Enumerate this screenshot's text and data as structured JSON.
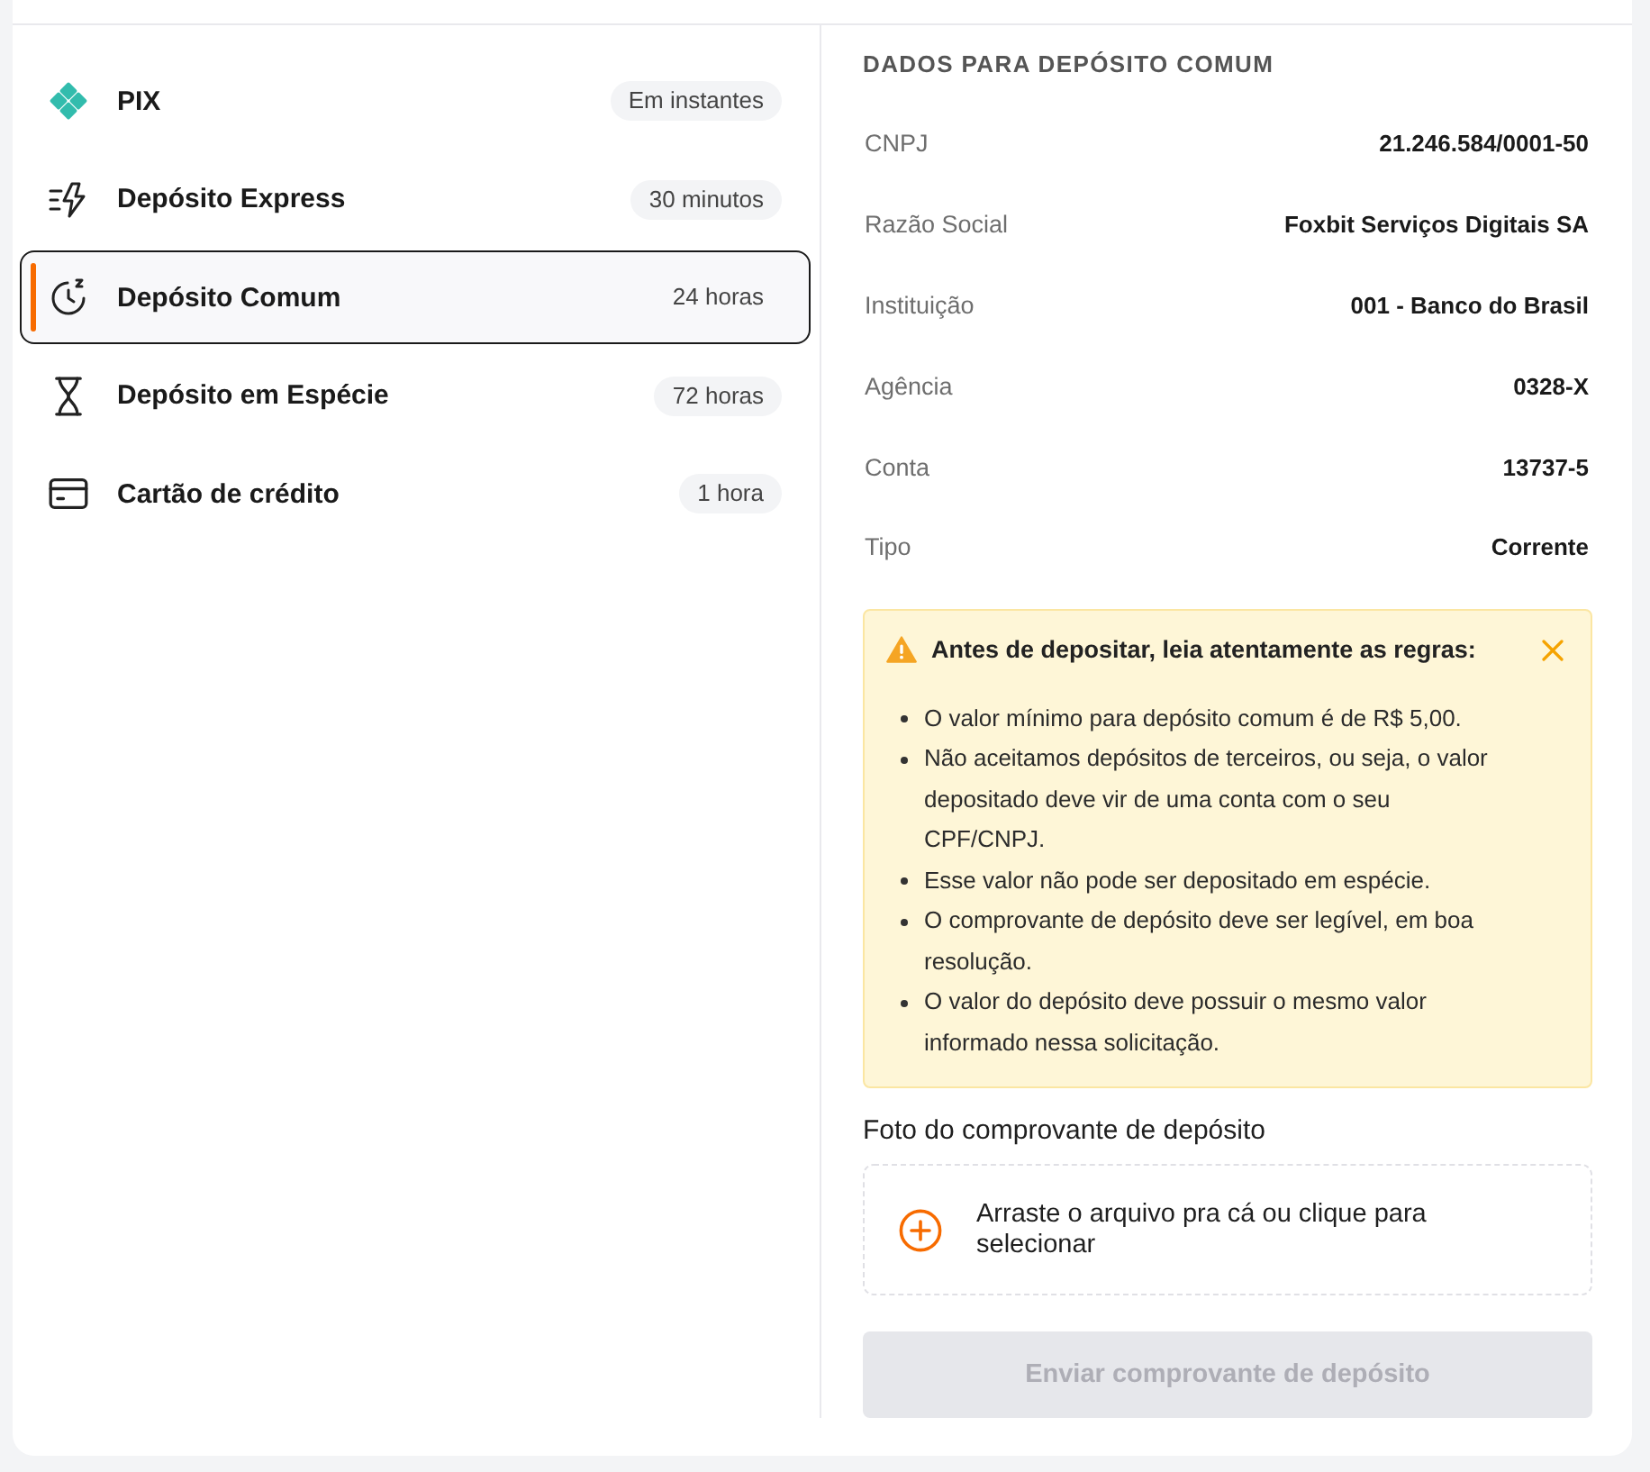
{
  "methods": [
    {
      "kind": "pix",
      "label": "PIX",
      "time": "Em instantes",
      "selected": false
    },
    {
      "kind": "express",
      "label": "Depósito Express",
      "time": "30 minutos",
      "selected": false
    },
    {
      "kind": "clock",
      "label": "Depósito Comum",
      "time": "24 horas",
      "selected": true
    },
    {
      "kind": "hourglass",
      "label": "Depósito em Espécie",
      "time": "72 horas",
      "selected": false
    },
    {
      "kind": "card",
      "label": "Cartão de crédito",
      "time": "1 hora",
      "selected": false
    }
  ],
  "details": {
    "title": "DADOS PARA DEPÓSITO COMUM",
    "rows": [
      {
        "label": "CNPJ",
        "value": "21.246.584/0001-50"
      },
      {
        "label": "Razão Social",
        "value": "Foxbit Serviços Digitais SA"
      },
      {
        "label": "Instituição",
        "value": "001 - Banco do Brasil"
      },
      {
        "label": "Agência",
        "value": "0328-X"
      },
      {
        "label": "Conta",
        "value": "13737-5"
      },
      {
        "label": "Tipo",
        "value": "Corrente"
      }
    ]
  },
  "alert": {
    "title": "Antes de depositar, leia atentamente as regras:",
    "rules": [
      "O valor mínimo para depósito comum é de R$ 5,00.",
      "Não aceitamos depósitos de terceiros, ou seja, o valor depositado deve vir de uma conta com o seu CPF/CNPJ.",
      "Esse valor não pode ser depositado em espécie.",
      "O comprovante de depósito deve ser legível, em boa resolução.",
      "O valor do depósito deve possuir o mesmo valor informado nessa solicitação."
    ]
  },
  "upload": {
    "label": "Foto do comprovante de depósito",
    "prompt": "Arraste o arquivo pra cá ou clique para selecionar"
  },
  "submit": {
    "label": "Enviar comprovante de depósito",
    "disabled": true
  }
}
